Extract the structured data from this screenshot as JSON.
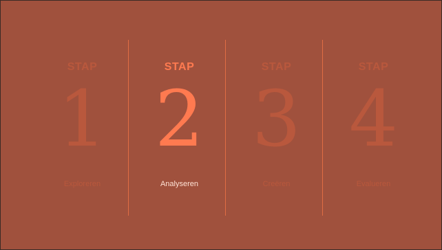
{
  "colors": {
    "background": "#a0513d",
    "inactive": "#b9583d",
    "active_accent": "#ff7a50",
    "active_label": "#ffe2d5",
    "divider": "#e06d45"
  },
  "steps": [
    {
      "heading": "STAP",
      "number": "1",
      "label": "Exploreren",
      "active": false
    },
    {
      "heading": "STAP",
      "number": "2",
      "label": "Analyseren",
      "active": true
    },
    {
      "heading": "STAP",
      "number": "3",
      "label": "Creëren",
      "active": false
    },
    {
      "heading": "STAP",
      "number": "4",
      "label": "Evalueren",
      "active": false
    }
  ]
}
